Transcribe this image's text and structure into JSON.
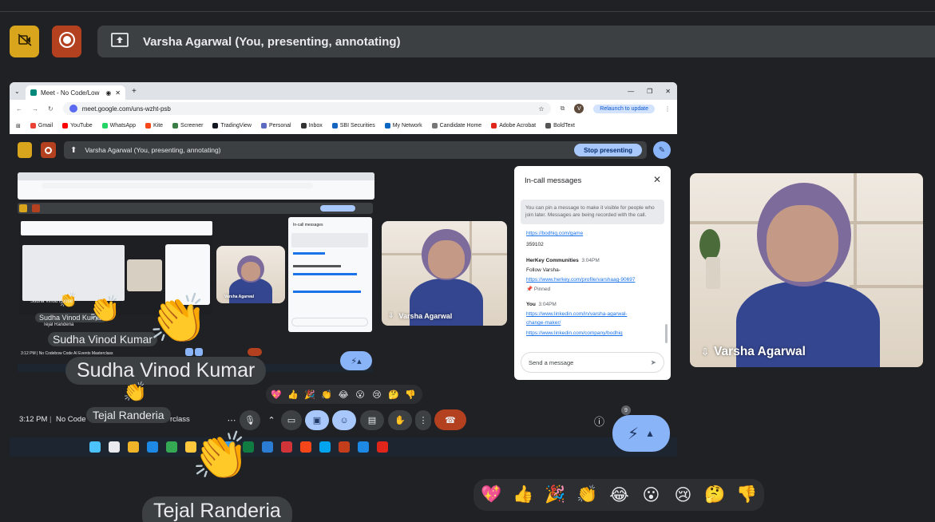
{
  "outer": {
    "presenting_label": "Varsha Agarwal (You, presenting, annotating)"
  },
  "browser": {
    "tab_title": "Meet - No Code/Low Code",
    "url": "meet.google.com/uns-wzht-psb",
    "profile_initial": "V",
    "relaunch_label": "Relaunch to update",
    "bookmarks": [
      {
        "label": "Gmail",
        "color": "#ea4335"
      },
      {
        "label": "YouTube",
        "color": "#ff0000"
      },
      {
        "label": "WhatsApp",
        "color": "#25d366"
      },
      {
        "label": "Kite",
        "color": "#f6461a"
      },
      {
        "label": "Screener",
        "color": "#3a7d44"
      },
      {
        "label": "TradingView",
        "color": "#131722"
      },
      {
        "label": "Personal",
        "color": "#5c6bc0"
      },
      {
        "label": "Inbox",
        "color": "#333333"
      },
      {
        "label": "SBI Securities",
        "color": "#1565c0"
      },
      {
        "label": "My Network",
        "color": "#0a66c2"
      },
      {
        "label": "Candidate Home",
        "color": "#777777"
      },
      {
        "label": "Adobe Acrobat",
        "color": "#e0261b"
      },
      {
        "label": "BoldText",
        "color": "#555555"
      }
    ]
  },
  "inner": {
    "presenting_label": "Varsha Agarwal (You, presenting, annotating)",
    "stop_label": "Stop presenting"
  },
  "mini": {
    "name_1": "Sudha Vinod Kumar",
    "name_2": "Tejal Randeria",
    "tile_name": "Varsha Agarwal"
  },
  "chat": {
    "title": "In-call messages",
    "info": "You can pin a message to make it visible for people who join later. Messages are being recorded with the call.",
    "link_1": "https://bodhiq.com/game",
    "code": "359102",
    "sender_1": "HerKey Communities",
    "time_1": "3:04PM",
    "message_1": "Follow Varsha-",
    "link_2": "https://www.herkey.com/profile/varshaag-90697",
    "pinned_label": "Pinned",
    "sender_2": "You",
    "time_2": "3:04PM",
    "link_3a": "https://www.linkedin.com/in/varsha-agarwal-",
    "link_3b": "change-maker/",
    "link_4": "https://www.linkedin.com/company/bodhiq",
    "input_placeholder": "Send a message"
  },
  "tiles": {
    "small_name": "Varsha Agarwal",
    "large_name": "Varsha Agarwal"
  },
  "overlay": {
    "name_sudha_small": "Sudha Vinod Kumar",
    "name_sudha_large": "Sudha Vinod Kumar",
    "name_tejal_small": "Tejal Randeria",
    "name_tejal_large": "Tejal Randeria"
  },
  "meeting": {
    "time": "3:12 PM",
    "separator": "|",
    "title": "No Code",
    "title_tail": "rclass",
    "badge_count": "9"
  },
  "reactions_small": [
    "💖",
    "👍",
    "🎉",
    "👏",
    "😂",
    "😮",
    "😢",
    "🤔",
    "👎"
  ],
  "reactions_large": [
    "💖",
    "👍",
    "🎉",
    "👏",
    "😂",
    "😮",
    "😢",
    "🤔",
    "👎"
  ],
  "colors": {
    "background": "#202124",
    "accent_blue": "#8ab4f8",
    "stop_button": "#a8c7fa",
    "end_call": "#b3411f",
    "hand_raise": "#d9a51c",
    "record": "#b3411f"
  },
  "icons": {
    "no_camera": "video-off-icon",
    "record": "record-icon",
    "present": "present-screen-icon",
    "annotate": "pen-icon",
    "lightning": "lightning-icon"
  }
}
